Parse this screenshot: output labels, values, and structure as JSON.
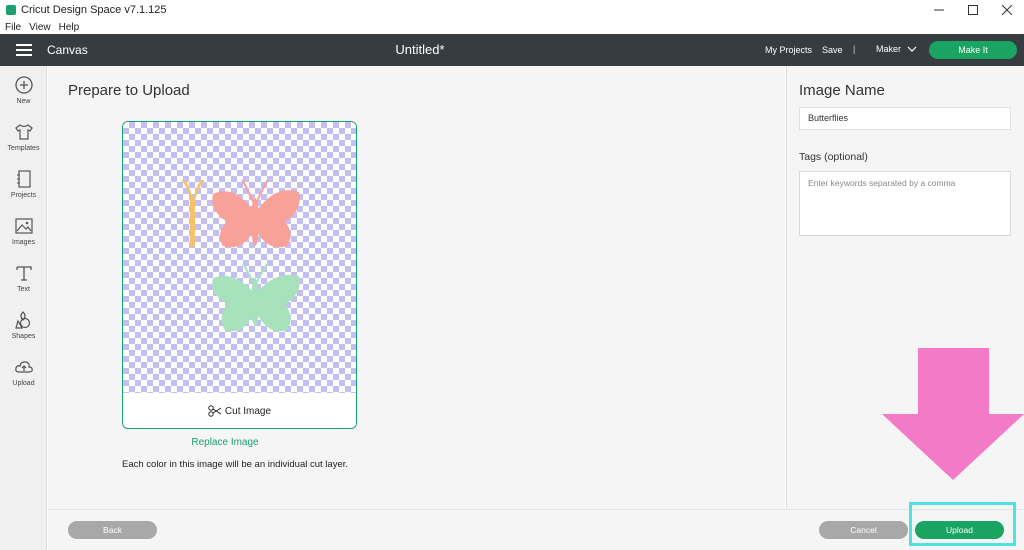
{
  "window": {
    "title": "Cricut Design Space  v7.1.125",
    "minimize": "—",
    "maximize": "☐",
    "close": "✕"
  },
  "menu": [
    "File",
    "View",
    "Help"
  ],
  "header": {
    "section": "Canvas",
    "document_title": "Untitled*",
    "my_projects": "My Projects",
    "save": "Save",
    "separator": "|",
    "machine": "Maker",
    "make_it": "Make It"
  },
  "sidebar": {
    "items": [
      {
        "label": "New",
        "icon": "plus-circle-icon"
      },
      {
        "label": "Templates",
        "icon": "tshirt-icon"
      },
      {
        "label": "Projects",
        "icon": "notebook-icon"
      },
      {
        "label": "Images",
        "icon": "image-icon"
      },
      {
        "label": "Text",
        "icon": "text-icon"
      },
      {
        "label": "Shapes",
        "icon": "shapes-icon"
      },
      {
        "label": "Upload",
        "icon": "cloud-upload-icon"
      }
    ]
  },
  "main": {
    "title": "Prepare to Upload",
    "cut_image_label": "Cut Image",
    "replace_image": "Replace Image",
    "info": "Each color in this image will be an individual cut layer.",
    "butterfly_colors": {
      "pink": "#f8a199",
      "green": "#a8e2bd",
      "orange": "#f7c06a"
    }
  },
  "panel": {
    "image_name_title": "Image Name",
    "image_name_value": "Butterflies",
    "tags_label": "Tags (optional)",
    "tags_placeholder": "Enter keywords separated by a comma"
  },
  "footer": {
    "back": "Back",
    "cancel": "Cancel",
    "upload": "Upload"
  },
  "colors": {
    "accent": "#19a462",
    "header_bg": "#373c41",
    "arrow": "#f27ac6",
    "highlight": "#4de3e0"
  }
}
